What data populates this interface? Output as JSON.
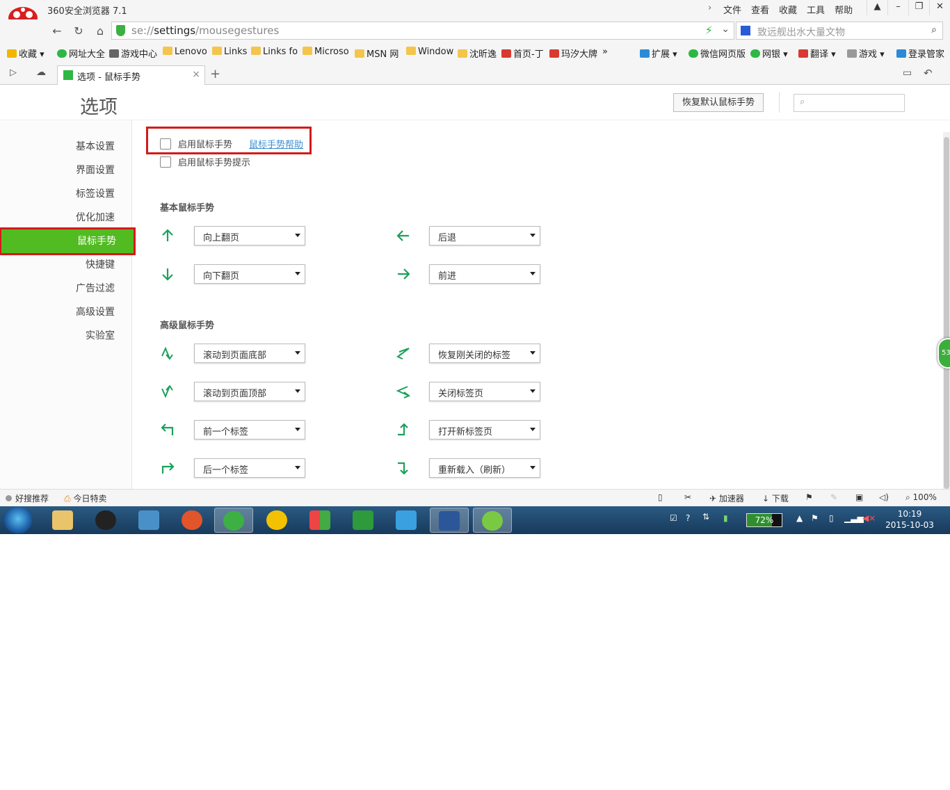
{
  "window": {
    "title": "360安全浏览器 7.1",
    "menu": [
      "文件",
      "查看",
      "收藏",
      "工具",
      "帮助"
    ]
  },
  "address": {
    "scheme": "se://",
    "host": "settings",
    "path": "/mousegestures",
    "search_placeholder": "致远舰出水大量文物"
  },
  "bookmarks": [
    {
      "label": "收藏",
      "icon": "star-icon"
    },
    {
      "label": "网址大全",
      "icon": "globe-icon"
    },
    {
      "label": "游戏中心",
      "icon": "gamepad-icon"
    },
    {
      "label": "Lenovo",
      "icon": "folder-icon"
    },
    {
      "label": "Links",
      "icon": "folder-icon"
    },
    {
      "label": "Links fo",
      "icon": "folder-icon"
    },
    {
      "label": "Microso",
      "icon": "folder-icon"
    },
    {
      "label": "MSN 网",
      "icon": "folder-icon"
    },
    {
      "label": "Window",
      "icon": "folder-icon"
    },
    {
      "label": "沈昕逸",
      "icon": "folder-icon"
    },
    {
      "label": "首页-丁",
      "icon": "page-icon"
    },
    {
      "label": "玛汐大牌",
      "icon": "page-icon"
    },
    {
      "label": "»",
      "icon": "more-icon"
    },
    {
      "label": "扩展",
      "icon": "extension-icon"
    },
    {
      "label": "微信网页版",
      "icon": "wechat-icon"
    },
    {
      "label": "网银",
      "icon": "bank-icon"
    },
    {
      "label": "翻译",
      "icon": "translate-icon"
    },
    {
      "label": "游戏",
      "icon": "game-icon"
    },
    {
      "label": "登录管家",
      "icon": "login-icon"
    }
  ],
  "tab": {
    "title": "选项 - 鼠标手势"
  },
  "page": {
    "title": "选项",
    "reset_button": "恢复默认鼠标手势",
    "search_placeholder": ""
  },
  "sidebar": [
    {
      "label": "基本设置",
      "active": false
    },
    {
      "label": "界面设置",
      "active": false
    },
    {
      "label": "标签设置",
      "active": false
    },
    {
      "label": "优化加速",
      "active": false
    },
    {
      "label": "鼠标手势",
      "active": true
    },
    {
      "label": "快捷键",
      "active": false
    },
    {
      "label": "广告过滤",
      "active": false
    },
    {
      "label": "高级设置",
      "active": false
    },
    {
      "label": "实验室",
      "active": false
    }
  ],
  "options": {
    "enable_gestures": {
      "label": "启用鼠标手势",
      "checked": false
    },
    "help_link": "鼠标手势帮助",
    "enable_hints": {
      "label": "启用鼠标手势提示",
      "checked": false
    }
  },
  "basic": {
    "title": "基本鼠标手势",
    "gestures": [
      {
        "gesture": "up",
        "action": "向上翻页"
      },
      {
        "gesture": "left",
        "action": "后退"
      },
      {
        "gesture": "down",
        "action": "向下翻页"
      },
      {
        "gesture": "right",
        "action": "前进"
      }
    ]
  },
  "advanced": {
    "title": "高级鼠标手势",
    "gestures": [
      {
        "gesture": "up-down",
        "action": "滚动到页面底部"
      },
      {
        "gesture": "right-left",
        "action": "恢复刚关闭的标签"
      },
      {
        "gesture": "down-up",
        "action": "滚动到页面顶部"
      },
      {
        "gesture": "left-right",
        "action": "关闭标签页"
      },
      {
        "gesture": "up-left",
        "action": "前一个标签"
      },
      {
        "gesture": "right-up",
        "action": "打开新标签页"
      },
      {
        "gesture": "up-right",
        "action": "后一个标签"
      },
      {
        "gesture": "right-down",
        "action": "重新载入（刷新）"
      }
    ]
  },
  "side_badge": "53",
  "statusbar": {
    "left": [
      "好搜推荐",
      "今日特卖"
    ],
    "accelerator": "加速器",
    "download": "下载",
    "zoom": "100%"
  },
  "taskbar": {
    "battery": "72%",
    "battery_level": 0.72,
    "time": "10:19",
    "date": "2015-10-03"
  },
  "colors": {
    "accent_green": "#52bb22",
    "highlight_red": "#d41a1a",
    "arrow_green": "#1aa15a",
    "link_blue": "#3d8fd3"
  }
}
